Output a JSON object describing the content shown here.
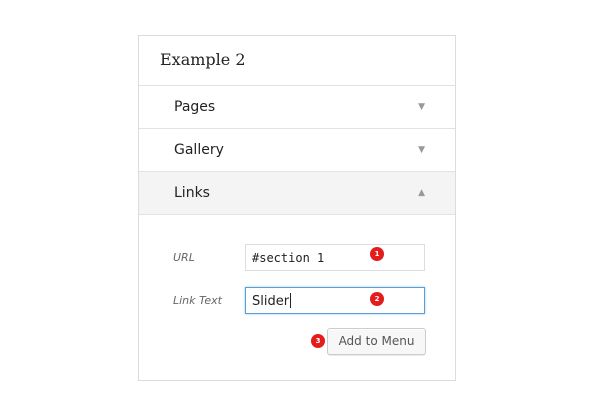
{
  "panel": {
    "title": "Example 2",
    "sections": [
      {
        "label": "Pages",
        "arrow": "▼",
        "expanded": false
      },
      {
        "label": "Gallery",
        "arrow": "▼",
        "expanded": false
      },
      {
        "label": "Links",
        "arrow": "▲",
        "expanded": true
      }
    ]
  },
  "links_form": {
    "url_label": "URL",
    "url_value": "#section 1",
    "link_text_label": "Link Text",
    "link_text_value": "Slider",
    "add_button": "Add to Menu"
  },
  "badges": [
    "1",
    "2",
    "3"
  ],
  "colors": {
    "badge": "#e41c1c",
    "active_section_bg": "#f4f4f4",
    "focus_border": "#5b9dd9"
  }
}
